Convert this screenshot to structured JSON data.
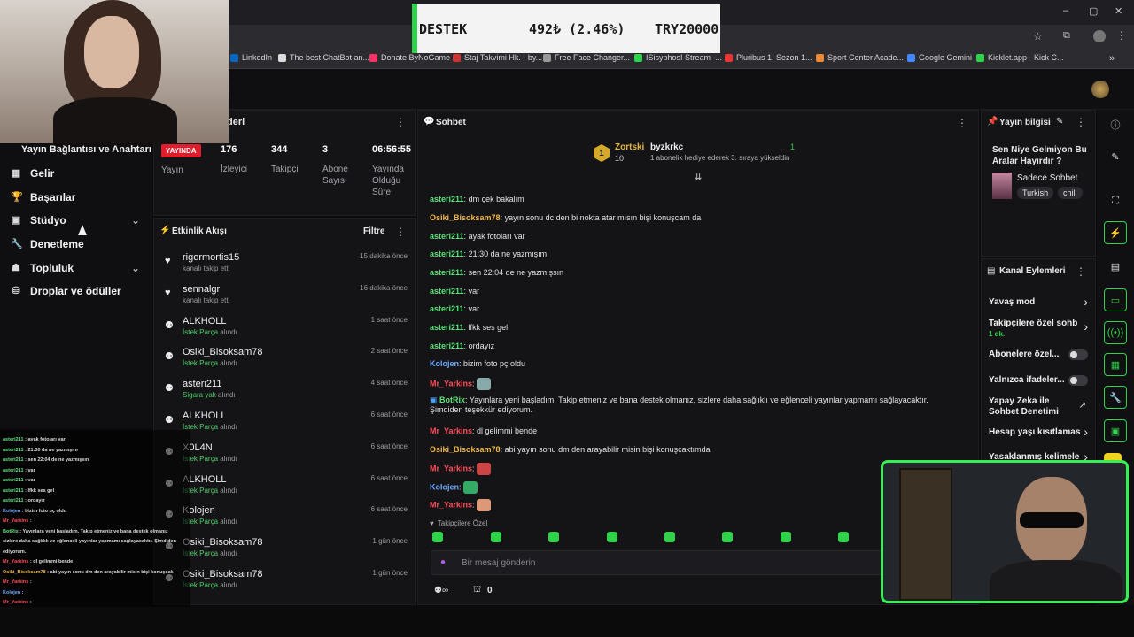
{
  "browser": {
    "bookmarks": [
      "LinkedIn",
      "The best ChatBot an...",
      "Donate ByNoGame",
      "Staj Takvimi Hk. - by...",
      "Free Face Changer...",
      "ISisyphosI Stream -...",
      "Pluribus 1. Sezon 1...",
      "Sport Center Acade...",
      "Google Gemini",
      "Kicklet.app - Kick C..."
    ],
    "window_controls": [
      "–",
      "▢",
      "✕"
    ]
  },
  "donation_bar": {
    "label": "DESTEK",
    "amount": "492₺ (2.46%)",
    "goal": "TRY20000"
  },
  "leftnav": {
    "header": "Yayın Bağlantısı ve Anahtarı",
    "items": [
      {
        "label": "Gelir",
        "icon": "chart-icon"
      },
      {
        "label": "Başarılar",
        "icon": "trophy-icon"
      },
      {
        "label": "Stüdyo",
        "icon": "studio-icon",
        "expandable": true
      },
      {
        "label": "Denetleme",
        "icon": "wrench-icon"
      },
      {
        "label": "Topluluk",
        "icon": "community-icon",
        "expandable": true
      },
      {
        "label": "Droplar ve ödüller",
        "icon": "gift-icon"
      }
    ]
  },
  "stats": {
    "title_partial": "deri",
    "live_badge": "YAYINDA",
    "stream_label": "Yayın",
    "viewers": "176",
    "viewers_label": "İzleyici",
    "followers": "344",
    "followers_label": "Takipçi",
    "subs": "3",
    "subs_label": "Abone Sayısı",
    "uptime": "06:56:55",
    "uptime_label": "Yayında Olduğu Süre"
  },
  "activity": {
    "title": "Etkinlik Akışı",
    "filter": "Filtre",
    "items": [
      {
        "name": "rigormortis15",
        "sub": "kanalı takip etti",
        "time": "15 dakika önce",
        "type": "follow"
      },
      {
        "name": "sennalgr",
        "sub": "kanalı takip etti",
        "time": "16 dakika önce",
        "type": "follow"
      },
      {
        "name": "ALKHOLL",
        "hl": "İstek Parça",
        "sub": "alındı",
        "time": "1 saat önce",
        "type": "reward"
      },
      {
        "name": "Osiki_Bisoksam78",
        "hl": "İstek Parça",
        "sub": "alındı",
        "time": "2 saat önce",
        "type": "reward"
      },
      {
        "name": "asteri211",
        "hl": "Sigara yak",
        "sub": "alındı",
        "time": "4 saat önce",
        "type": "reward"
      },
      {
        "name": "ALKHOLL",
        "hl": "İstek Parça",
        "sub": "alındı",
        "time": "6 saat önce",
        "type": "reward"
      },
      {
        "name": "X0L4N",
        "hl": "İstek Parça",
        "sub": "alındı",
        "time": "6 saat önce",
        "type": "reward"
      },
      {
        "name": "ALKHOLL",
        "hl": "İstek Parça",
        "sub": "alındı",
        "time": "6 saat önce",
        "type": "reward"
      },
      {
        "name": "Kolojen",
        "hl": "İstek Parça",
        "sub": "alındı",
        "time": "6 saat önce",
        "type": "reward"
      },
      {
        "name": "Osiki_Bisoksam78",
        "hl": "İstek Parça",
        "sub": "alındı",
        "time": "1 gün önce",
        "type": "reward"
      },
      {
        "name": "Osiki_Bisoksam78",
        "hl": "İstek Parça",
        "sub": "alındı",
        "time": "1 gün önce",
        "type": "reward"
      }
    ]
  },
  "chat": {
    "title": "Sohbet",
    "pinned": {
      "gifter": "Zortski",
      "gift_count": "10",
      "recipient": "byzkrkc",
      "count": "1",
      "text": "1 abonelik hediye ederek 3. sıraya yükseldin"
    },
    "messages": [
      {
        "user": "asteri211",
        "color": "#5ee37a",
        "text": "dm çek bakalım"
      },
      {
        "user": "Osiki_Bisoksam78",
        "color": "#f0b84a",
        "text": "yayın sonu dc den bi nokta atar mısın bişi konuşcam da"
      },
      {
        "user": "asteri211",
        "color": "#5ee37a",
        "text": "ayak fotoları var"
      },
      {
        "user": "asteri211",
        "color": "#5ee37a",
        "text": "21:30 da ne yazmışım"
      },
      {
        "user": "asteri211",
        "color": "#5ee37a",
        "text": "sen 22:04 de ne yazmışsın"
      },
      {
        "user": "asteri211",
        "color": "#5ee37a",
        "text": "var"
      },
      {
        "user": "asteri211",
        "color": "#5ee37a",
        "text": "var"
      },
      {
        "user": "asteri211",
        "color": "#5ee37a",
        "text": "lfkk ses gel"
      },
      {
        "user": "asteri211",
        "color": "#5ee37a",
        "text": "ordayız"
      },
      {
        "user": "Kolojen",
        "color": "#6aa8ff",
        "text": "bizim foto pç oldu"
      },
      {
        "user": "Mr_Yarkins",
        "color": "#ff4d5a",
        "text": ""
      },
      {
        "user": "BotRix",
        "color": "#5ee37a",
        "text": "Yayınlara yeni başladım. Takip etmeniz ve bana destek olmanız, sizlere daha sağlıklı ve eğlenceli yayınlar yapmamı sağlayacaktır.",
        "text2": "Şimdiden teşekkür ediyorum."
      },
      {
        "user": "Mr_Yarkins",
        "color": "#ff4d5a",
        "text": "dl gelimmi bende"
      },
      {
        "user": "Osiki_Bisoksam78",
        "color": "#f0b84a",
        "text": "abi yayın sonu dm den arayabilir misin bişi konuşcaktımda"
      },
      {
        "user": "Mr_Yarkins",
        "color": "#ff4d5a",
        "text": ""
      },
      {
        "user": "Kolojen",
        "color": "#6aa8ff",
        "text": ""
      },
      {
        "user": "Mr_Yarkins",
        "color": "#ff4d5a",
        "text": ""
      }
    ],
    "followers_only": "Takipçilere Özel",
    "placeholder": "Bir mesaj gönderin",
    "points": "0"
  },
  "info": {
    "title": "Yayın bilgisi",
    "stream_title": "Sen Niye Gelmiyon Bu Aralar Hayırdır ?",
    "category": "Sadece Sohbet",
    "tags": [
      "Turkish",
      "chill"
    ]
  },
  "actions": {
    "title": "Kanal Eylemleri",
    "items": [
      {
        "label": "Yavaş mod",
        "control": "arrow"
      },
      {
        "label": "Takipçilere özel sohbe",
        "sub": "1 dk.",
        "control": "arrow"
      },
      {
        "label": "Abonelere özel...",
        "control": "toggle"
      },
      {
        "label": "Yalnızca ifadeler...",
        "control": "toggle"
      },
      {
        "label": "Yapay Zeka ile Sohbet Denetimi",
        "control": "external"
      },
      {
        "label": "Hesap yaşı kısıtlamas",
        "control": "arrow"
      },
      {
        "label": "Yasaklanmış kelimele",
        "control": "arrow"
      }
    ]
  },
  "overlay_chat": [
    {
      "user": "asteri211",
      "color": "#5ee37a",
      "text": "ayak fotoları var"
    },
    {
      "user": "asteri211",
      "color": "#5ee37a",
      "text": "21:30 da ne yazmışım"
    },
    {
      "user": "asteri211",
      "color": "#5ee37a",
      "text": "sen 22:04 de ne yazmışsın"
    },
    {
      "user": "asteri211",
      "color": "#5ee37a",
      "text": "var"
    },
    {
      "user": "asteri211",
      "color": "#5ee37a",
      "text": "var"
    },
    {
      "user": "asteri211",
      "color": "#5ee37a",
      "text": "lfkk ses gel"
    },
    {
      "user": "asteri211",
      "color": "#5ee37a",
      "text": "ordayız"
    },
    {
      "user": "Kolojen",
      "color": "#6aa8ff",
      "text": "bizim foto pç oldu"
    },
    {
      "user": "Mr_Yarkins",
      "color": "#ff4d5a",
      "text": ""
    },
    {
      "user": "BotRix",
      "color": "#5ee37a",
      "text": "Yayınlara yeni başladım. Takip etmeniz ve bana destek olmanız"
    },
    {
      "user": "",
      "color": "#ddd",
      "text": "sizlere daha sağlıklı ve eğlenceli yayınlar yapmamı sağlayacaktır. Şimdiden"
    },
    {
      "user": "",
      "color": "#ddd",
      "text": "ediyorum."
    },
    {
      "user": "Mr_Yarkins",
      "color": "#ff4d5a",
      "text": "dl gelimmi bende"
    },
    {
      "user": "Osiki_Bisoksam78",
      "color": "#f0b84a",
      "text": "abi yayın sonu dm den arayabilir misin bişi konuşcak"
    },
    {
      "user": "Mr_Yarkins",
      "color": "#ff4d5a",
      "text": ""
    },
    {
      "user": "Kolojen",
      "color": "#6aa8ff",
      "text": ""
    },
    {
      "user": "Mr_Yarkins",
      "color": "#ff4d5a",
      "text": ""
    }
  ],
  "colors": {
    "accent": "#2fd24a",
    "live": "#e01d2b",
    "panel": "#141416"
  }
}
